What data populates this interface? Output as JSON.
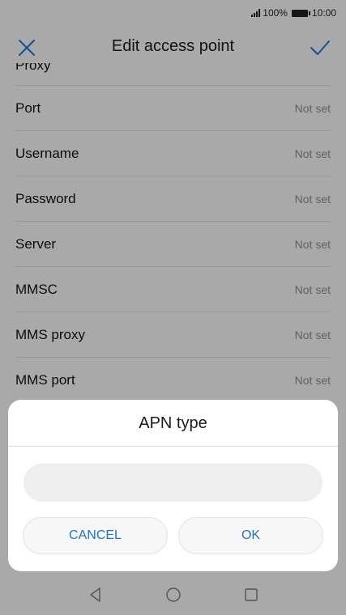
{
  "status_bar": {
    "battery": "100%",
    "time": "10:00"
  },
  "app_bar": {
    "title": "Edit access point"
  },
  "list": {
    "partial_label": "Proxy",
    "rows": [
      {
        "label": "Port",
        "value": "Not set"
      },
      {
        "label": "Username",
        "value": "Not set"
      },
      {
        "label": "Password",
        "value": "Not set"
      },
      {
        "label": "Server",
        "value": "Not set"
      },
      {
        "label": "MMSC",
        "value": "Not set"
      },
      {
        "label": "MMS proxy",
        "value": "Not set"
      },
      {
        "label": "MMS port",
        "value": "Not set"
      }
    ]
  },
  "dialog": {
    "title": "APN type",
    "input_value": "",
    "cancel_label": "CANCEL",
    "ok_label": "OK"
  },
  "colors": {
    "accent": "#1a73d1",
    "scrim": "rgba(0,0,0,0.30)"
  }
}
